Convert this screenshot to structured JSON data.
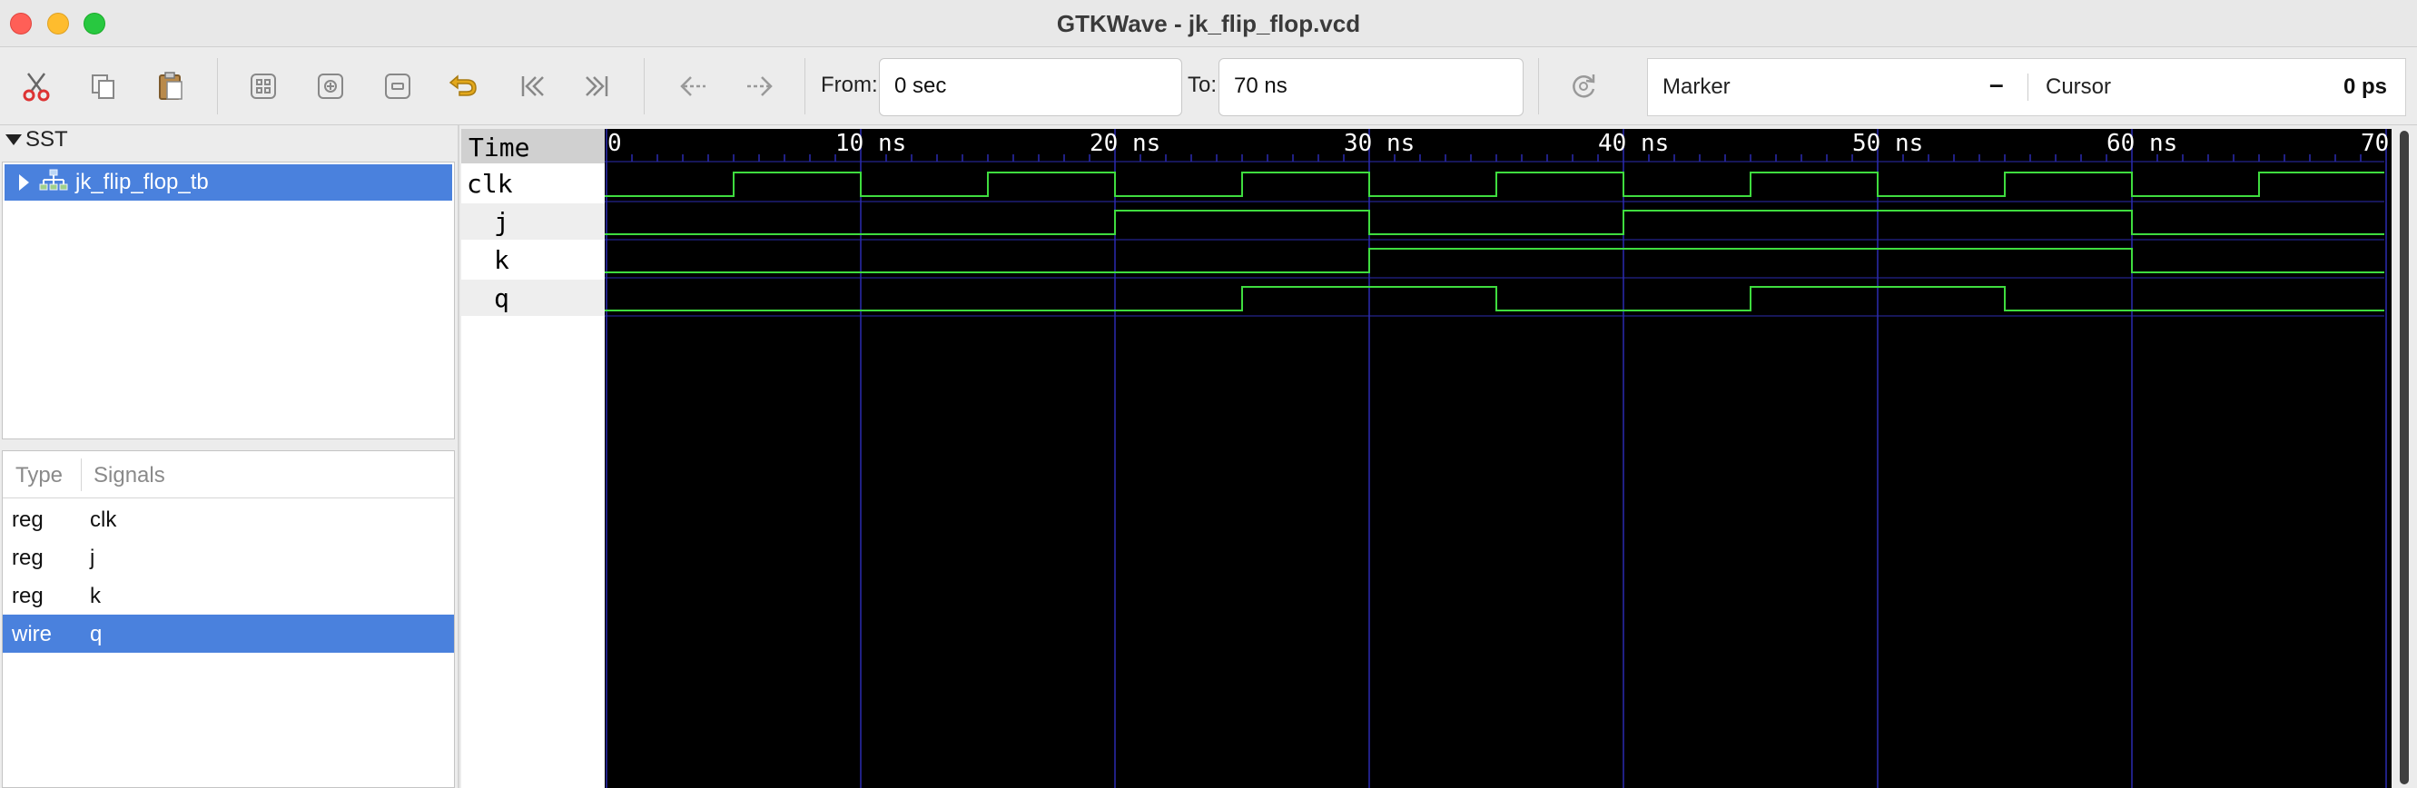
{
  "window": {
    "title": "GTKWave - jk_flip_flop.vcd"
  },
  "toolbar": {
    "buttons": [
      "cut-icon",
      "copy-icon",
      "paste-icon",
      "zoom-fit-icon",
      "zoom-in-icon",
      "zoom-out-icon",
      "undo-zoom-icon",
      "zoom-start-icon",
      "zoom-end-icon",
      "find-prev-edge-icon",
      "find-next-edge-icon",
      "reload-icon"
    ],
    "from_label": "From:",
    "from_value": "0 sec",
    "to_label": "To:",
    "to_value": "70 ns",
    "marker_label": "Marker",
    "marker_value": "–",
    "cursor_label": "Cursor",
    "cursor_value": "0 ps"
  },
  "sst": {
    "header": "SST",
    "tree": [
      {
        "label": "jk_flip_flop_tb",
        "selected": true,
        "icon": "module-hierarchy-icon"
      }
    ]
  },
  "signals_panel": {
    "col_type": "Type",
    "col_signals": "Signals",
    "rows": [
      {
        "type": "reg",
        "name": "clk",
        "selected": false
      },
      {
        "type": "reg",
        "name": "j",
        "selected": false
      },
      {
        "type": "reg",
        "name": "k",
        "selected": false
      },
      {
        "type": "wire",
        "name": "q",
        "selected": true
      }
    ]
  },
  "wave": {
    "time_header": "Time",
    "time_range_ns": [
      0,
      70
    ],
    "major_ticks": [
      {
        "t": 0,
        "label": "0"
      },
      {
        "t": 10,
        "label": "10 ns"
      },
      {
        "t": 20,
        "label": "20 ns"
      },
      {
        "t": 30,
        "label": "30 ns"
      },
      {
        "t": 40,
        "label": "40 ns"
      },
      {
        "t": 50,
        "label": "50 ns"
      },
      {
        "t": 60,
        "label": "60 ns"
      },
      {
        "t": 70,
        "label": "70"
      }
    ],
    "minor_tick_ns": 1,
    "colors": {
      "trace": "#3fdc3f",
      "grid": "#2b2bb0",
      "background": "#000000",
      "ruler_text": "#ffffff"
    },
    "traces": [
      {
        "name": "clk",
        "indent": false,
        "transitions": [
          [
            0,
            0
          ],
          [
            5,
            1
          ],
          [
            10,
            0
          ],
          [
            15,
            1
          ],
          [
            20,
            0
          ],
          [
            25,
            1
          ],
          [
            30,
            0
          ],
          [
            35,
            1
          ],
          [
            40,
            0
          ],
          [
            45,
            1
          ],
          [
            50,
            0
          ],
          [
            55,
            1
          ],
          [
            60,
            0
          ],
          [
            65,
            1
          ]
        ]
      },
      {
        "name": "j",
        "indent": true,
        "transitions": [
          [
            0,
            0
          ],
          [
            20,
            1
          ],
          [
            30,
            0
          ],
          [
            40,
            1
          ],
          [
            60,
            0
          ]
        ]
      },
      {
        "name": "k",
        "indent": true,
        "transitions": [
          [
            0,
            0
          ],
          [
            30,
            1
          ],
          [
            60,
            0
          ]
        ]
      },
      {
        "name": "q",
        "indent": true,
        "transitions": [
          [
            0,
            0
          ],
          [
            25,
            1
          ],
          [
            35,
            0
          ],
          [
            45,
            1
          ],
          [
            55,
            0
          ]
        ]
      }
    ]
  }
}
